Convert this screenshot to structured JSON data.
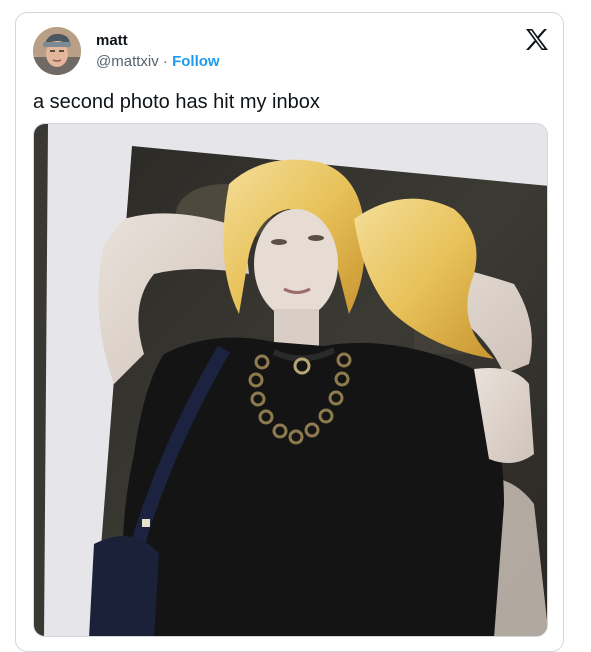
{
  "tweet": {
    "display_name": "matt",
    "handle": "@mattxiv",
    "separator": "·",
    "follow_label": "Follow",
    "text": "a second photo has hit my inbox"
  },
  "icons": {
    "brand": "x-logo-icon"
  },
  "colors": {
    "follow_link": "#1d9bf0",
    "text_primary": "#0f1419",
    "text_secondary": "#536471",
    "border": "#cfd9de"
  }
}
